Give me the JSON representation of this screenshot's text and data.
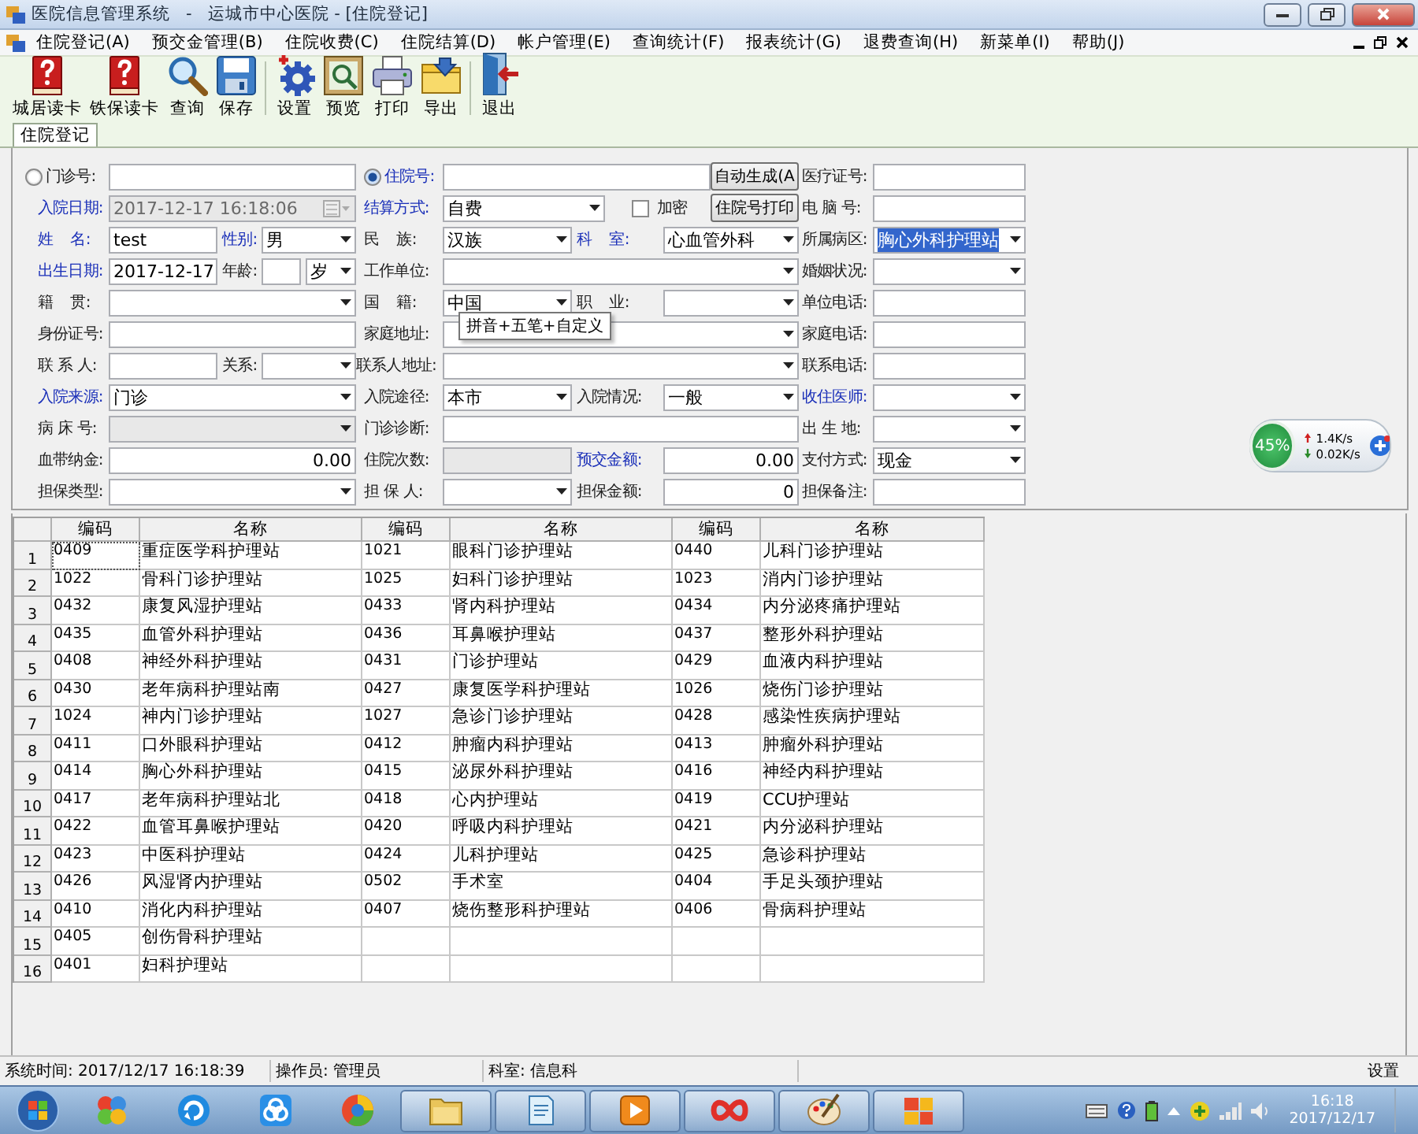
{
  "window": {
    "title": "医院信息管理系统   -   运城市中心医院 - [住院登记]"
  },
  "menu": [
    "住院登记(A)",
    "预交金管理(B)",
    "住院收费(C)",
    "住院结算(D)",
    "帐户管理(E)",
    "查询统计(F)",
    "报表统计(G)",
    "退费查询(H)",
    "新菜单(I)",
    "帮助(J)"
  ],
  "toolbar": [
    {
      "label": "城居读卡",
      "separator_before": false
    },
    {
      "label": "铁保读卡",
      "separator_before": false
    },
    {
      "label": "查询",
      "separator_before": false
    },
    {
      "label": "保存",
      "separator_before": false
    },
    {
      "label": "设置",
      "separator_before": true
    },
    {
      "label": "预览",
      "separator_before": false
    },
    {
      "label": "打印",
      "separator_before": false
    },
    {
      "label": "导出",
      "separator_before": false
    },
    {
      "label": "退出",
      "separator_before": true
    }
  ],
  "tabs": [
    {
      "label": "住院登记",
      "selected": true
    }
  ],
  "form": {
    "rows": [
      {
        "left": [
          {
            "kind": "radio",
            "label": "门诊号:",
            "selected": false
          }
        ],
        "middle": [
          {
            "kind": "radio",
            "label": "住院号:",
            "selected": true
          },
          {
            "kind": "button",
            "label": "自动生成(A"
          }
        ],
        "right": {
          "kind": "input",
          "label": "医疗证号:"
        }
      },
      {
        "left": [
          {
            "kind": "datetime",
            "label": "入院日期:",
            "highlighted": true,
            "value": "2017-12-17 16:18:06",
            "disabled": true
          }
        ],
        "middle": [
          {
            "kind": "select",
            "label": "结算方式:",
            "highlighted": true,
            "value": "自费"
          },
          {
            "kind": "checkbox",
            "label": "加密",
            "checked": false
          },
          {
            "kind": "button",
            "label": "住院号打印"
          }
        ],
        "right": {
          "kind": "input",
          "label": "电 脑 号:"
        }
      },
      {
        "left": [
          {
            "kind": "input",
            "label": "姓    名:",
            "highlighted": true,
            "value": "test"
          },
          {
            "kind": "select",
            "label": "性别:",
            "highlighted": true,
            "value": "男"
          }
        ],
        "middle": [
          {
            "kind": "select",
            "label": "民    族:",
            "value": "汉族"
          },
          {
            "kind": "select",
            "label": "科    室:",
            "highlighted": true,
            "value": "心血管外科"
          }
        ],
        "right": {
          "kind": "select",
          "label": "所属病区:",
          "value": "胸心外科护理站",
          "value_selected": true
        }
      },
      {
        "left": [
          {
            "kind": "date",
            "label": "出生日期:",
            "highlighted": true,
            "value": "2017-12-17"
          },
          {
            "kind": "input",
            "label": "年龄:",
            "unit": "岁"
          }
        ],
        "middle": [
          {
            "kind": "select",
            "label": "工作单位:"
          }
        ],
        "right": {
          "kind": "select",
          "label": "婚姻状况:"
        }
      },
      {
        "left": [
          {
            "kind": "select",
            "label": "籍    贯:"
          }
        ],
        "middle": [
          {
            "kind": "select",
            "label": "国    籍:",
            "value": "中国"
          },
          {
            "kind": "select",
            "label": "职    业:"
          }
        ],
        "right": {
          "kind": "input",
          "label": "单位电话:"
        }
      },
      {
        "left": [
          {
            "kind": "input",
            "label": "身份证号:"
          }
        ],
        "middle": [
          {
            "kind": "select",
            "label": "家庭地址:"
          }
        ],
        "right": {
          "kind": "input",
          "label": "家庭电话:"
        }
      },
      {
        "left": [
          {
            "kind": "input",
            "label": "联 系 人:"
          },
          {
            "kind": "select",
            "label": "关系:"
          }
        ],
        "middle": [
          {
            "kind": "select",
            "label": "联系人地址:"
          }
        ],
        "right": {
          "kind": "input",
          "label": "联系电话:"
        }
      },
      {
        "left": [
          {
            "kind": "select",
            "label": "入院来源:",
            "highlighted": true,
            "value": "门诊"
          }
        ],
        "middle": [
          {
            "kind": "select",
            "label": "入院途径:",
            "value": "本市"
          },
          {
            "kind": "select",
            "label": "入院情况:",
            "value": "一般"
          }
        ],
        "right": {
          "kind": "select",
          "label": "收住医师:",
          "highlighted": true
        }
      },
      {
        "left": [
          {
            "kind": "select",
            "label": "病 床 号:",
            "disabled": true
          }
        ],
        "middle": [
          {
            "kind": "input",
            "label": "门诊诊断:"
          }
        ],
        "right": {
          "kind": "select",
          "label": "出 生 地:"
        }
      },
      {
        "left": [
          {
            "kind": "number",
            "label": "血带纳金:",
            "value": "0.00"
          }
        ],
        "middle": [
          {
            "kind": "input",
            "label": "住院次数:",
            "disabled": true
          },
          {
            "kind": "number",
            "label": "预交金额:",
            "highlighted": true,
            "value": "0.00"
          }
        ],
        "right": {
          "kind": "select",
          "label": "支付方式:",
          "value": "现金"
        }
      },
      {
        "left": [
          {
            "kind": "select",
            "label": "担保类型:"
          }
        ],
        "middle": [
          {
            "kind": "select",
            "label": "担 保 人:"
          },
          {
            "kind": "number",
            "label": "担保金额:",
            "value": "0"
          }
        ],
        "right": {
          "kind": "input",
          "label": "担保备注:"
        }
      }
    ]
  },
  "tooltip": "拼音+五笔+自定义",
  "grid": {
    "columns": [
      "编码",
      "名称",
      "编码",
      "名称",
      "编码",
      "名称"
    ],
    "rows": [
      {
        "number": "1",
        "cells": [
          "0409",
          "重症医学科护理站",
          "1021",
          "眼科门诊护理站",
          "0440",
          "儿科门诊护理站"
        ]
      },
      {
        "number": "2",
        "cells": [
          "1022",
          "骨科门诊护理站",
          "1025",
          "妇科门诊护理站",
          "1023",
          "消内门诊护理站"
        ]
      },
      {
        "number": "3",
        "cells": [
          "0432",
          "康复风湿护理站",
          "0433",
          "肾内科护理站",
          "0434",
          "内分泌疼痛护理站"
        ]
      },
      {
        "number": "4",
        "cells": [
          "0435",
          "血管外科护理站",
          "0436",
          "耳鼻喉护理站",
          "0437",
          "整形外科护理站"
        ]
      },
      {
        "number": "5",
        "cells": [
          "0408",
          "神经外科护理站",
          "0431",
          "门诊护理站",
          "0429",
          "血液内科护理站"
        ]
      },
      {
        "number": "6",
        "cells": [
          "0430",
          "老年病科护理站南",
          "0427",
          "康复医学科护理站",
          "1026",
          "烧伤门诊护理站"
        ]
      },
      {
        "number": "7",
        "cells": [
          "1024",
          "神内门诊护理站",
          "1027",
          "急诊门诊护理站",
          "0428",
          "感染性疾病护理站"
        ]
      },
      {
        "number": "8",
        "cells": [
          "0411",
          "口外眼科护理站",
          "0412",
          "肿瘤内科护理站",
          "0413",
          "肿瘤外科护理站"
        ]
      },
      {
        "number": "9",
        "cells": [
          "0414",
          "胸心外科护理站",
          "0415",
          "泌尿外科护理站",
          "0416",
          "神经内科护理站"
        ]
      },
      {
        "number": "10",
        "cells": [
          "0417",
          "老年病科护理站北",
          "0418",
          "心内护理站",
          "0419",
          "CCU护理站"
        ]
      },
      {
        "number": "11",
        "cells": [
          "0422",
          "血管耳鼻喉护理站",
          "0420",
          "呼吸内科护理站",
          "0421",
          "内分泌科护理站"
        ]
      },
      {
        "number": "12",
        "cells": [
          "0423",
          "中医科护理站",
          "0424",
          "儿科护理站",
          "0425",
          "急诊科护理站"
        ]
      },
      {
        "number": "13",
        "cells": [
          "0426",
          "风湿肾内护理站",
          "0502",
          "手术室",
          "0404",
          "手足头颈护理站"
        ]
      },
      {
        "number": "14",
        "cells": [
          "0410",
          "消化内科护理站",
          "0407",
          "烧伤整形科护理站",
          "0406",
          "骨病科护理站"
        ]
      },
      {
        "number": "15",
        "cells": [
          "0405",
          "创伤骨科护理站"
        ]
      },
      {
        "number": "16",
        "cells": [
          "0401",
          "妇科护理站"
        ]
      }
    ]
  },
  "status_bar": [
    "系统时间: 2017/12/17 16:18:39",
    "操作员: 管理员",
    "科室: 信息科"
  ],
  "status_settings": "设置",
  "speed_widget": {
    "percent": "45%",
    "upload": "1.4K/s",
    "download": "0.02K/s"
  },
  "clock": {
    "time": "16:18",
    "date": "2017/12/17"
  }
}
